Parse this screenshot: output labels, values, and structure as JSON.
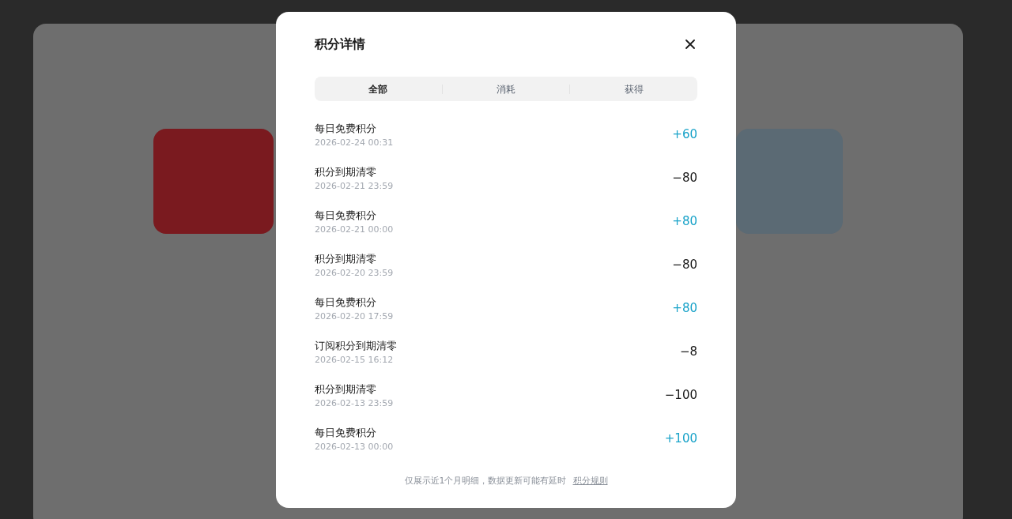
{
  "dialog": {
    "title": "积分详情",
    "tabs": [
      {
        "label": "全部",
        "selected": true
      },
      {
        "label": "消耗",
        "selected": false
      },
      {
        "label": "获得",
        "selected": false
      }
    ],
    "records": [
      {
        "title": "每日免费积分",
        "time": "2026-02-24 00:31",
        "amount": "+60",
        "kind": "gain"
      },
      {
        "title": "积分到期清零",
        "time": "2026-02-21 23:59",
        "amount": "−80",
        "kind": "spend"
      },
      {
        "title": "每日免费积分",
        "time": "2026-02-21 00:00",
        "amount": "+80",
        "kind": "gain"
      },
      {
        "title": "积分到期清零",
        "time": "2026-02-20 23:59",
        "amount": "−80",
        "kind": "spend"
      },
      {
        "title": "每日免费积分",
        "time": "2026-02-20 17:59",
        "amount": "+80",
        "kind": "gain"
      },
      {
        "title": "订阅积分到期清零",
        "time": "2026-02-15 16:12",
        "amount": "−8",
        "kind": "spend"
      },
      {
        "title": "积分到期清零",
        "time": "2026-02-13 23:59",
        "amount": "−100",
        "kind": "spend"
      },
      {
        "title": "每日免费积分",
        "time": "2026-02-13 00:00",
        "amount": "+100",
        "kind": "gain"
      }
    ],
    "footer": {
      "note": "仅展示近1个月明细，数据更新可能有延时",
      "link": "积分规则"
    }
  }
}
